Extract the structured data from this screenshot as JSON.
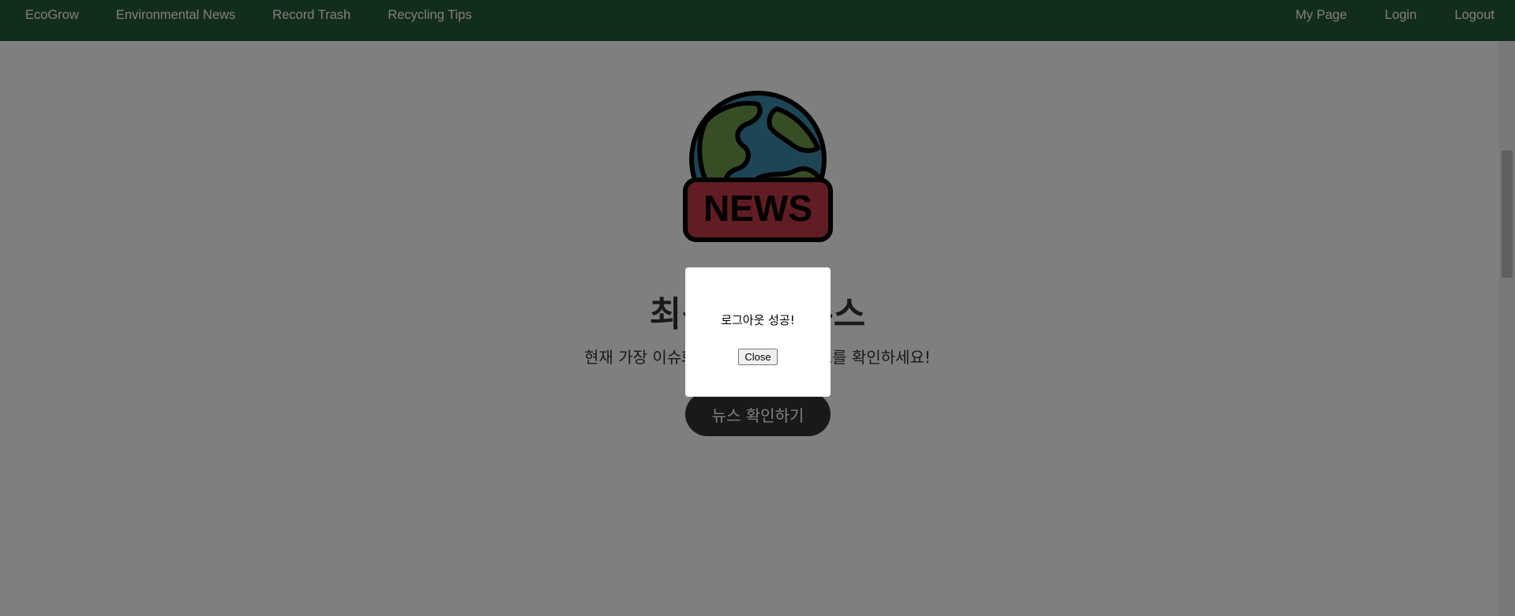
{
  "nav": {
    "brand": "EcoGrow",
    "links": [
      "Environmental News",
      "Record Trash",
      "Recycling Tips"
    ],
    "right_links": [
      "My Page",
      "Login",
      "Logout"
    ]
  },
  "hero": {
    "logo_text": "NEWS",
    "title": "최신 환경 뉴스",
    "subtitle": "현재 가장 이슈화 되고 있는 환경 뉴스를 확인하세요!",
    "button_label": "뉴스 확인하기"
  },
  "modal": {
    "message": "로그아웃 성공!",
    "close_label": "Close"
  },
  "colors": {
    "navbar": "#275a36",
    "globe_ocean": "#3d8aa6",
    "globe_land": "#6f9a4a",
    "news_badge": "#c23b46",
    "button": "#333333"
  }
}
